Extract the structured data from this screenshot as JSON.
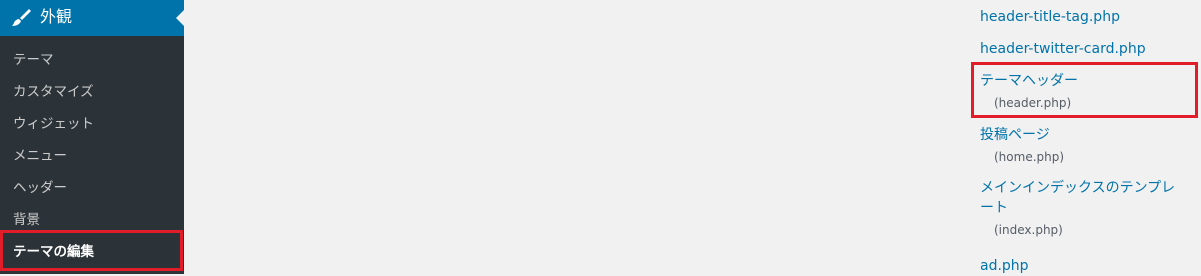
{
  "sidebar": {
    "section": {
      "icon": "paintbrush-icon",
      "label": "外観"
    },
    "items": [
      {
        "label": "テーマ"
      },
      {
        "label": "カスタマイズ"
      },
      {
        "label": "ウィジェット"
      },
      {
        "label": "メニュー"
      },
      {
        "label": "ヘッダー"
      },
      {
        "label": "背景"
      },
      {
        "label": "テーマの編集",
        "current": true
      }
    ]
  },
  "files": [
    {
      "name": "header-title-tag.php"
    },
    {
      "name": "header-twitter-card.php"
    },
    {
      "name": "テーマヘッダー",
      "file": "(header.php)"
    },
    {
      "name": "投稿ページ",
      "file": "(home.php)"
    },
    {
      "name": "メインインデックスのテンプレート",
      "file": "(index.php)"
    },
    {
      "name": "ad.php"
    }
  ],
  "colors": {
    "highlight": "#e21d2a",
    "link": "#0073aa",
    "menu_active": "#0073aa",
    "sidebar": "#23282d"
  }
}
